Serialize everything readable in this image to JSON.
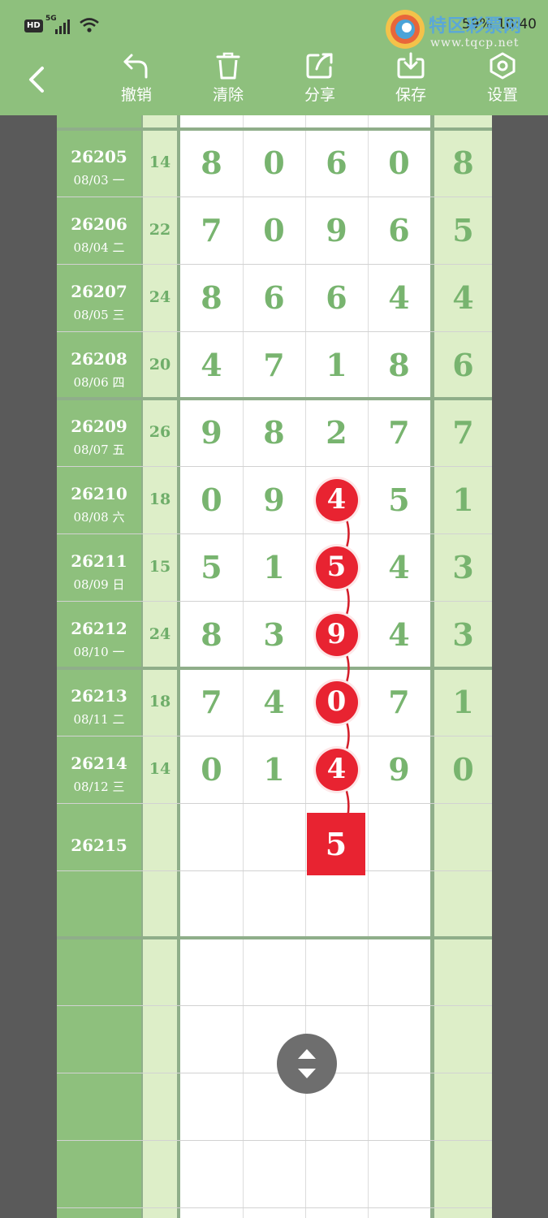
{
  "status_bar": {
    "hd": "HD",
    "network": "5G",
    "battery_time": "59% 10:40"
  },
  "watermark": {
    "name": "特区彩票网",
    "url": "www.tqcp.net"
  },
  "toolbar": {
    "undo_label": "撤销",
    "clear_label": "清除",
    "share_label": "分享",
    "save_label": "保存",
    "settings_label": "设置"
  },
  "rows": [
    {
      "issue": "26205",
      "date": "08/03 一",
      "sum": "14",
      "digits": [
        "8",
        "0",
        "6",
        "0"
      ],
      "last": "8"
    },
    {
      "issue": "26206",
      "date": "08/04 二",
      "sum": "22",
      "digits": [
        "7",
        "0",
        "9",
        "6"
      ],
      "last": "5"
    },
    {
      "issue": "26207",
      "date": "08/05 三",
      "sum": "24",
      "digits": [
        "8",
        "6",
        "6",
        "4"
      ],
      "last": "4"
    },
    {
      "issue": "26208",
      "date": "08/06 四",
      "sum": "20",
      "digits": [
        "4",
        "7",
        "1",
        "8"
      ],
      "last": "6"
    },
    {
      "issue": "26209",
      "date": "08/07 五",
      "sum": "26",
      "digits": [
        "9",
        "8",
        "2",
        "7"
      ],
      "last": "7"
    },
    {
      "issue": "26210",
      "date": "08/08 六",
      "sum": "18",
      "digits": [
        "0",
        "9",
        "4",
        "5"
      ],
      "last": "1"
    },
    {
      "issue": "26211",
      "date": "08/09 日",
      "sum": "15",
      "digits": [
        "5",
        "1",
        "5",
        "4"
      ],
      "last": "3"
    },
    {
      "issue": "26212",
      "date": "08/10 一",
      "sum": "24",
      "digits": [
        "8",
        "3",
        "9",
        "4"
      ],
      "last": "3"
    },
    {
      "issue": "26213",
      "date": "08/11 二",
      "sum": "18",
      "digits": [
        "7",
        "4",
        "0",
        "7"
      ],
      "last": "1"
    },
    {
      "issue": "26214",
      "date": "08/12 三",
      "sum": "14",
      "digits": [
        "0",
        "1",
        "4",
        "9"
      ],
      "last": "0"
    }
  ],
  "next_issue": "26215",
  "predicted_digit": "5",
  "colors": {
    "green_header": "#8ec07d",
    "green_column": "#8ec07d",
    "light_green": "#ddeec8",
    "red_ball": "#e82331"
  }
}
